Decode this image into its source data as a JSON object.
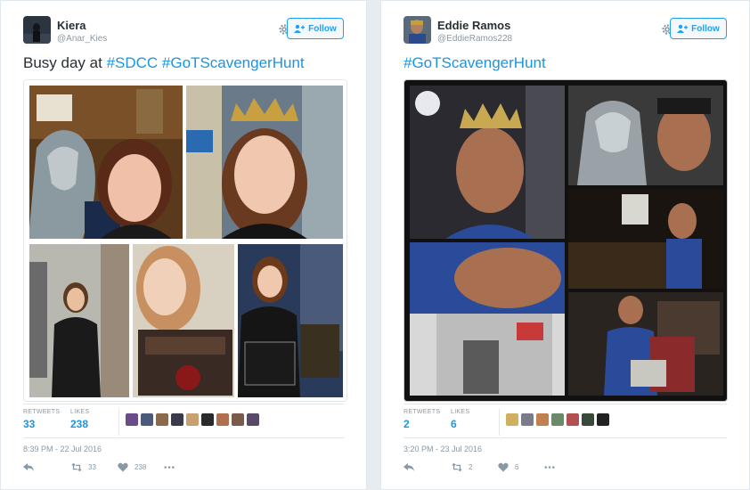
{
  "tweets": [
    {
      "name": "Kiera",
      "handle": "@Anar_Kies",
      "follow_label": "Follow",
      "text_prefix": "Busy day at ",
      "hashtags": [
        "#SDCC",
        "#GoTScavengerHunt"
      ],
      "stats": {
        "retweets_label": "RETWEETS",
        "retweets": "33",
        "likes_label": "LIKES",
        "likes": "238"
      },
      "timestamp": "8:39 PM - 22 Jul 2016",
      "actions": {
        "retweet_count": "33",
        "like_count": "238"
      },
      "liker_avatar_colors": [
        "#6b4c8a",
        "#4a5a7a",
        "#8a6a4a",
        "#3a3a4a",
        "#c9a070",
        "#2a2a2a",
        "#b07050",
        "#7a5a4a",
        "#5a4a6a"
      ]
    },
    {
      "name": "Eddie Ramos",
      "handle": "@EddieRamos228",
      "follow_label": "Follow",
      "text_prefix": "",
      "hashtags": [
        "#GoTScavengerHunt"
      ],
      "stats": {
        "retweets_label": "RETWEETS",
        "retweets": "2",
        "likes_label": "LIKES",
        "likes": "6"
      },
      "timestamp": "3:20 PM - 23 Jul 2016",
      "actions": {
        "retweet_count": "2",
        "like_count": "6"
      },
      "liker_avatar_colors": [
        "#d0b060",
        "#7a7a8a",
        "#c08050",
        "#6a8a6a",
        "#b05050",
        "#3a4a3a",
        "#222222"
      ]
    }
  ]
}
